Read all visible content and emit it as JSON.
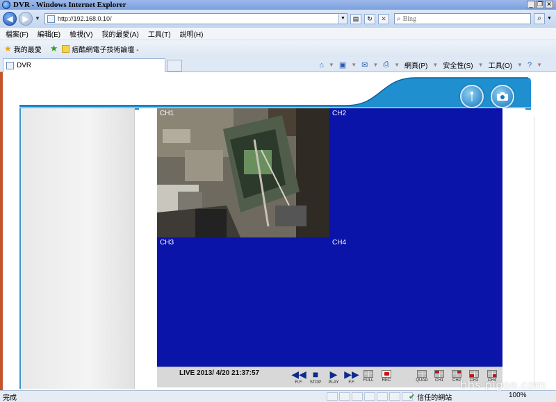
{
  "window": {
    "title": "DVR - Windows Internet Explorer"
  },
  "address": {
    "url": "http://192.168.0.10/",
    "search_placeholder": "Bing"
  },
  "menu": [
    "檔案(F)",
    "編輯(E)",
    "檢視(V)",
    "我的最愛(A)",
    "工具(T)",
    "說明(H)"
  ],
  "favorites": {
    "label": "我的最愛",
    "item": "痞酷網電子技術論壇 -"
  },
  "tab": {
    "title": "DVR"
  },
  "command": {
    "page": "網頁(P)",
    "safety": "安全性(S)",
    "tools": "工具(O)"
  },
  "dvr": {
    "channels": [
      "CH1",
      "CH2",
      "CH3",
      "CH4"
    ],
    "live_status": "LIVE 2013/ 4/20 21:37:57",
    "controls": {
      "rf": "R.F.",
      "stop": "STOP",
      "play": "PLAY",
      "ff": "F.F.",
      "full": "FULL",
      "rec": "REC",
      "quad": "QUAD",
      "ch1": "CH1",
      "ch2": "CH2",
      "ch3": "CH3",
      "ch4": "CH4"
    },
    "colors": {
      "video_bg": "#0a14a9",
      "header_blue": "#1f8fd0",
      "control_glyph": "#0d2a8f"
    }
  },
  "status": {
    "text": "完成",
    "zone": "信任的網站",
    "zoom": "100%"
  },
  "watermark": "bbs.pigoo.com"
}
